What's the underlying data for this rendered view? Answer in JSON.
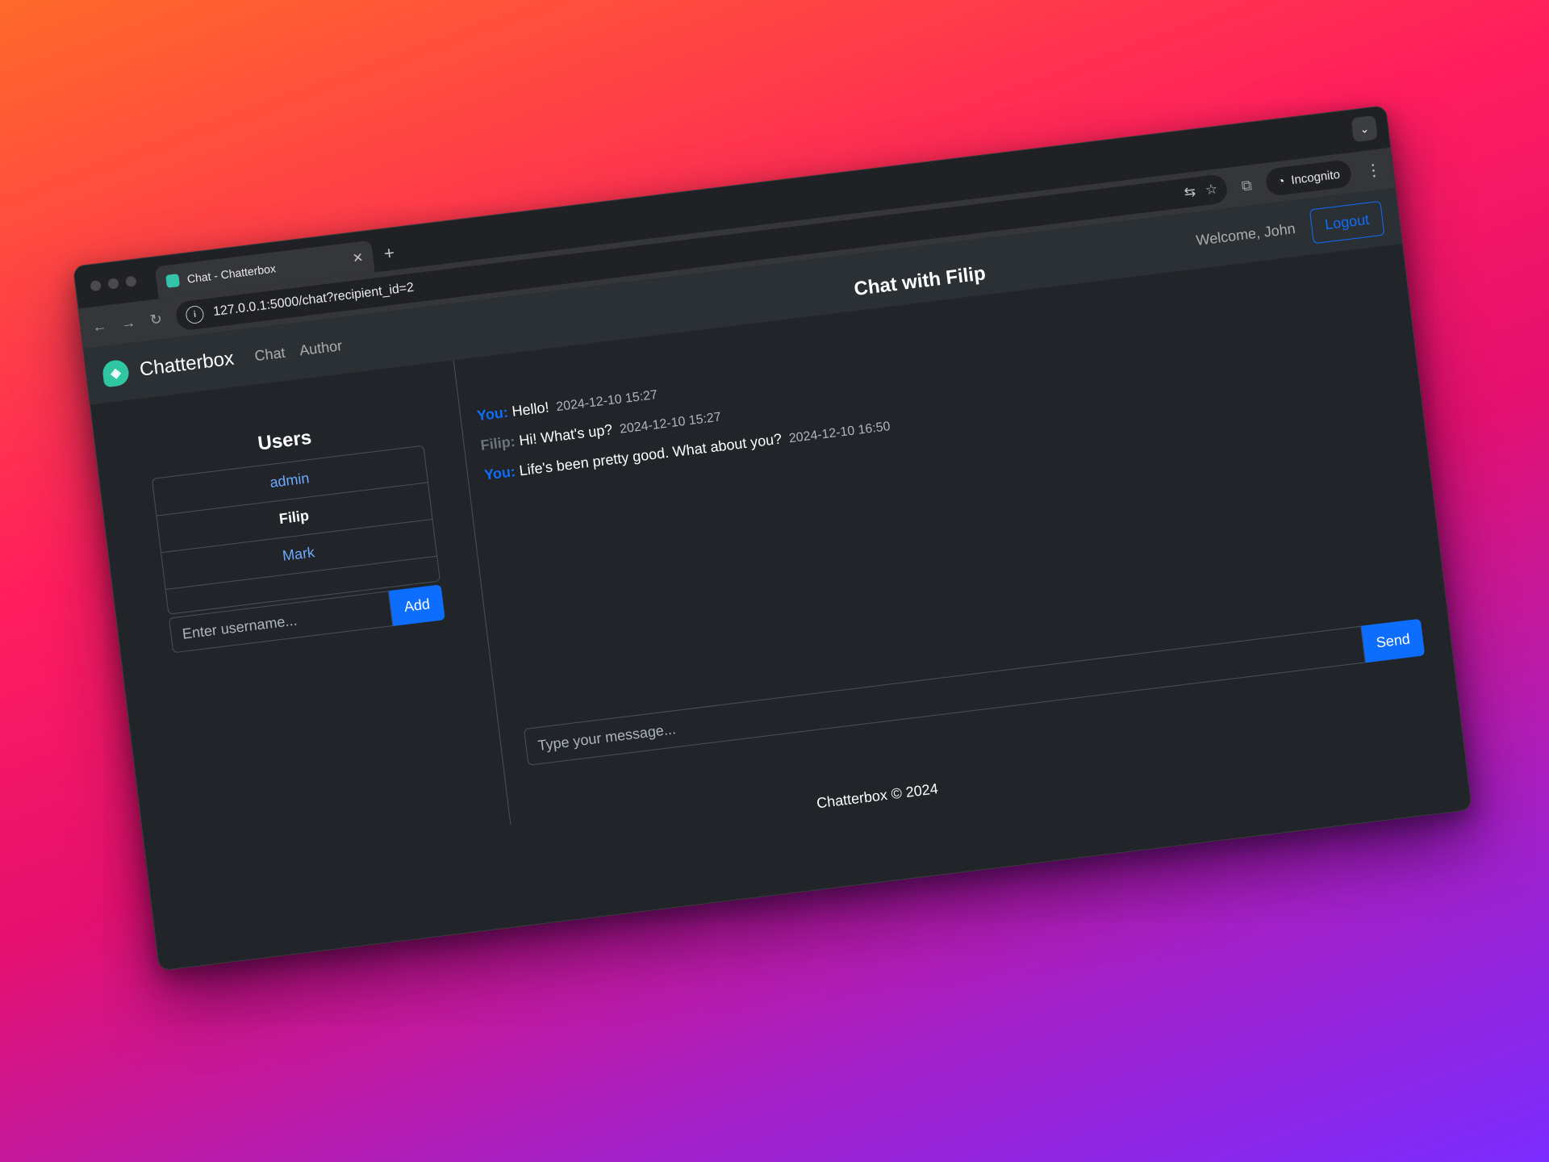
{
  "browser": {
    "tab_title": "Chat - Chatterbox",
    "tab_close": "✕",
    "new_tab": "+",
    "url": "127.0.0.1:5000/chat?recipient_id=2",
    "incognito_label": "Incognito",
    "icons": [
      "back-icon",
      "forward-icon",
      "reload-icon",
      "site-info-icon",
      "translate-icon",
      "star-icon",
      "extensions-icon",
      "incognito-icon",
      "menu-icon",
      "tab-search-icon"
    ]
  },
  "navbar": {
    "brand": "Chatterbox",
    "links": [
      "Chat",
      "Author"
    ],
    "welcome": "Welcome, John",
    "logout": "Logout"
  },
  "sidebar": {
    "title": "Users",
    "users": [
      {
        "name": "admin",
        "active": false
      },
      {
        "name": "Filip",
        "active": true
      },
      {
        "name": "Mark",
        "active": false
      }
    ],
    "add_placeholder": "Enter username...",
    "add_button": "Add"
  },
  "chat": {
    "title": "Chat with Filip",
    "messages": [
      {
        "sender": "You:",
        "text": "Hello!",
        "time": "2024-12-10 15:27",
        "mine": true
      },
      {
        "sender": "Filip:",
        "text": "Hi! What's up?",
        "time": "2024-12-10 15:27",
        "mine": false
      },
      {
        "sender": "You:",
        "text": "Life's been pretty good. What about you?",
        "time": "2024-12-10 16:50",
        "mine": true
      }
    ],
    "input_placeholder": "Type your message...",
    "send_button": "Send"
  },
  "footer": {
    "text": "Chatterbox © 2024"
  },
  "colors": {
    "primary": "#0d6efd",
    "navbar_bg": "#2b3035",
    "body_bg": "#212529",
    "logo": "#2fc7a2"
  }
}
